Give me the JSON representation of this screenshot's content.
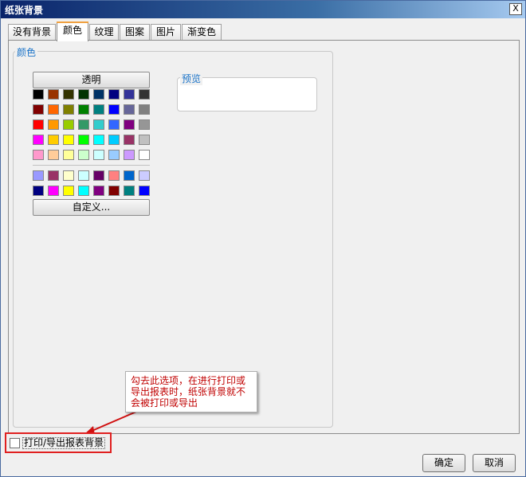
{
  "window": {
    "title": "纸张背景",
    "close_label": "X"
  },
  "tabs": [
    {
      "label": "没有背景",
      "active": false
    },
    {
      "label": "颜色",
      "active": true
    },
    {
      "label": "纹理",
      "active": false
    },
    {
      "label": "图案",
      "active": false
    },
    {
      "label": "图片",
      "active": false
    },
    {
      "label": "渐变色",
      "active": false
    }
  ],
  "color_group": {
    "label": "颜色"
  },
  "palette": {
    "transparent_label": "透明",
    "custom_label": "自定义...",
    "standard_rows": [
      [
        "#000000",
        "#993300",
        "#333300",
        "#003300",
        "#003366",
        "#000080",
        "#333399",
        "#333333"
      ],
      [
        "#800000",
        "#ff6600",
        "#808000",
        "#008000",
        "#008080",
        "#0000ff",
        "#666699",
        "#808080"
      ],
      [
        "#ff0000",
        "#ff9900",
        "#99cc00",
        "#339966",
        "#33cccc",
        "#3366ff",
        "#800080",
        "#969696"
      ],
      [
        "#ff00ff",
        "#ffcc00",
        "#ffff00",
        "#00ff00",
        "#00ffff",
        "#00ccff",
        "#993366",
        "#c0c0c0"
      ],
      [
        "#ff99cc",
        "#ffcc99",
        "#ffff99",
        "#ccffcc",
        "#ccffff",
        "#99ccff",
        "#cc99ff",
        "#ffffff"
      ]
    ],
    "extra_rows": [
      [
        "#9999ff",
        "#993366",
        "#ffffcc",
        "#ccffff",
        "#660066",
        "#ff8080",
        "#0066cc",
        "#ccccff"
      ],
      [
        "#000080",
        "#ff00ff",
        "#ffff00",
        "#00ffff",
        "#800080",
        "#800000",
        "#008080",
        "#0000ff"
      ]
    ]
  },
  "preview": {
    "label": "预览"
  },
  "callout": {
    "text": "勾去此选项，在进行打印或导出报表时，纸张背景就不会被打印或导出"
  },
  "print_option": {
    "label": "打印/导出报表背景",
    "checked": false
  },
  "buttons": {
    "ok": "确定",
    "cancel": "取消"
  }
}
